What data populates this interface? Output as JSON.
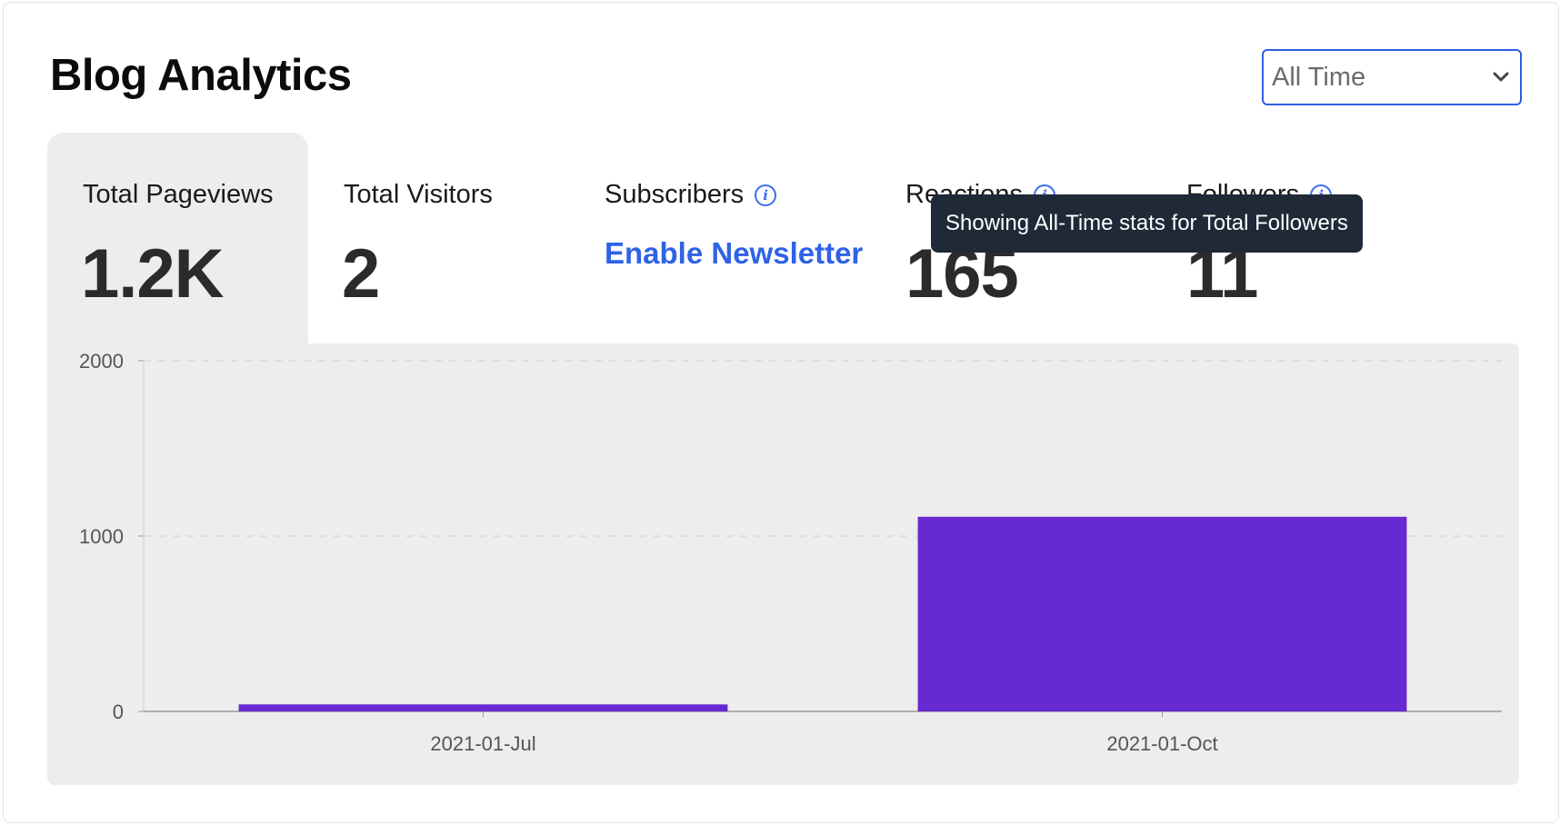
{
  "header": {
    "title": "Blog Analytics",
    "range_select": {
      "value": "All Time",
      "icon": "chevron-down-icon"
    }
  },
  "stats": [
    {
      "label": "Total Pageviews",
      "value": "1.2K",
      "active": true
    },
    {
      "label": "Total Visitors",
      "value": "2"
    },
    {
      "label": "Subscribers",
      "info_icon": true,
      "link": "Enable Newsletter"
    },
    {
      "label": "Reactions",
      "info_icon": true,
      "value": "165"
    },
    {
      "label": "Followers",
      "info_icon": true,
      "value": "11"
    }
  ],
  "tooltip": {
    "text": "Showing All-Time stats for Total Followers"
  },
  "colors": {
    "accent": "#2f62e6",
    "bar": "#6629d2",
    "panel": "#ededed",
    "tooltip_bg": "#1f2937"
  },
  "chart_data": {
    "type": "bar",
    "categories": [
      "2021-01-Jul",
      "2021-01-Oct"
    ],
    "values": [
      40,
      1110
    ],
    "ylim": [
      0,
      2000
    ],
    "yticks": [
      "0",
      "1000",
      "2000"
    ],
    "grid": true,
    "xlabel": "",
    "ylabel": "",
    "title": ""
  }
}
